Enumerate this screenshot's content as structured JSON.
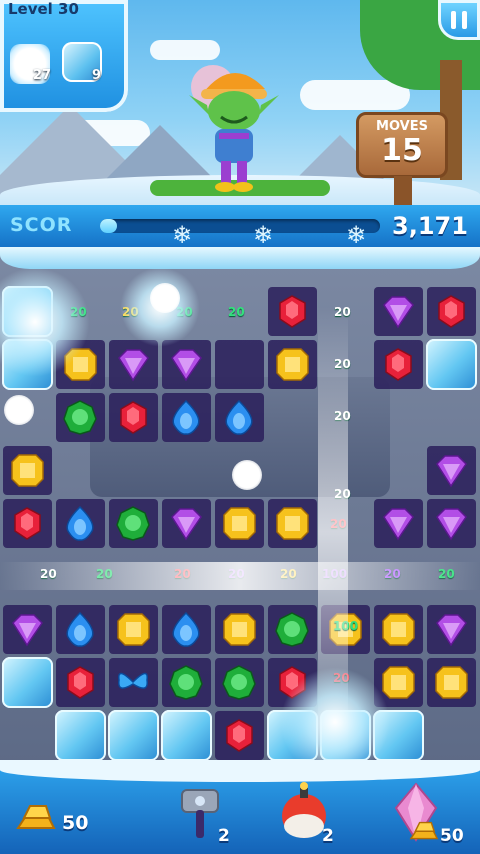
{
  "level": {
    "label": "Level 30"
  },
  "goals": [
    {
      "icon": "snowball-icon",
      "count": "27"
    },
    {
      "icon": "ice-block-icon",
      "count": "9"
    }
  ],
  "moves": {
    "label": "MOVES",
    "value": "15"
  },
  "score": {
    "label": "SCOR",
    "value": "3,171",
    "progress_fraction": 0.06
  },
  "board": {
    "cols": 9,
    "rows": 9,
    "grid": [
      [
        "ice",
        "blank",
        "blank",
        "blank",
        "blank",
        "red",
        "blank",
        "purple",
        "red"
      ],
      [
        "ice",
        "yellow",
        "purple",
        "purple",
        "empty",
        "yellow",
        "blank",
        "red",
        "ice"
      ],
      [
        "blank",
        "green",
        "red",
        "blue",
        "blue",
        "blank",
        "blank",
        "blank",
        "blank"
      ],
      [
        "yellow",
        "blank",
        "blank",
        "blank",
        "blank",
        "blank",
        "blank",
        "blank",
        "purple"
      ],
      [
        "red",
        "blue",
        "green",
        "purple",
        "yellow",
        "yellow",
        "blank",
        "purple",
        "purple"
      ],
      [
        "blank",
        "blank",
        "blank",
        "blank",
        "blank",
        "blank",
        "blank",
        "blank",
        "blank"
      ],
      [
        "purple",
        "blue",
        "yellow",
        "blue",
        "yellow",
        "green",
        "yellow",
        "yellow",
        "purple"
      ],
      [
        "ice",
        "red",
        "butterfly",
        "green",
        "green",
        "red",
        "blank",
        "yellow",
        "yellow"
      ],
      [
        "blank",
        "ice",
        "ice",
        "ice",
        "red",
        "ice",
        "ice",
        "ice",
        "blank"
      ]
    ],
    "points": [
      {
        "text": "20",
        "color": "#34e07d"
      },
      {
        "text": "20",
        "color": "#ffd84a"
      },
      {
        "text": "20",
        "color": "#34e07d"
      },
      {
        "text": "20",
        "color": "#34e07d"
      },
      {
        "text": "20",
        "color": "#ffffff"
      },
      {
        "text": "20",
        "color": "#ffffff"
      },
      {
        "text": "20",
        "color": "#ffffff"
      },
      {
        "text": "20",
        "color": "#ffffff"
      },
      {
        "text": "20",
        "color": "#ff4a5a"
      },
      {
        "text": "20",
        "color": "#ffffff"
      },
      {
        "text": "20",
        "color": "#34e07d"
      },
      {
        "text": "20",
        "color": "#ff4a5a"
      },
      {
        "text": "20",
        "color": "#b46bff"
      },
      {
        "text": "20",
        "color": "#ffd84a"
      },
      {
        "text": "100",
        "color": "#b46bff"
      },
      {
        "text": "20",
        "color": "#b46bff"
      },
      {
        "text": "20",
        "color": "#34e07d"
      },
      {
        "text": "100",
        "color": "#34e07d"
      },
      {
        "text": "20",
        "color": "#ff4a5a"
      }
    ]
  },
  "boosters": [
    {
      "name": "gold-bars-icon",
      "count": "50"
    },
    {
      "name": "hammer-icon",
      "count": "2"
    },
    {
      "name": "bomb-icon",
      "count": "2"
    },
    {
      "name": "crystal-icon",
      "count": "50"
    }
  ],
  "colors": {
    "red": "#e8213a",
    "yellow": "#f6c21c",
    "purple": "#b24ee6",
    "green": "#1fae3a",
    "blue": "#2b8ff0"
  }
}
